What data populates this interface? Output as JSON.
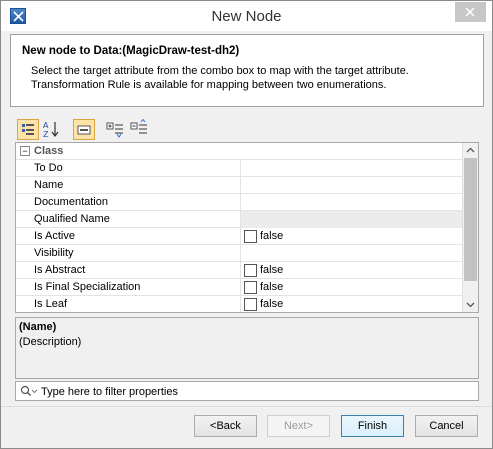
{
  "window": {
    "title": "New Node"
  },
  "header": {
    "title": "New node to Data:(MagicDraw-test-dh2)",
    "line1": "Select the target attribute from the combo box to map with the target attribute.",
    "line2": "Transformation Rule is available for mapping between two enumerations."
  },
  "toolbar": {
    "buttons": [
      "categorized-view",
      "alphabetic-sort",
      "show-descriptions",
      "expand-all",
      "collapse-all"
    ]
  },
  "grid": {
    "group": "Class",
    "rows": [
      {
        "name": "To Do",
        "value": ""
      },
      {
        "name": "Name",
        "value": ""
      },
      {
        "name": "Documentation",
        "value": ""
      },
      {
        "name": "Qualified Name",
        "value": ""
      },
      {
        "name": "Is Active",
        "value": "false"
      },
      {
        "name": "Visibility",
        "value": ""
      },
      {
        "name": "Is Abstract",
        "value": "false"
      },
      {
        "name": "Is Final Specialization",
        "value": "false"
      },
      {
        "name": "Is Leaf",
        "value": "false"
      }
    ]
  },
  "description": {
    "title": "(Name)",
    "text": "(Description)"
  },
  "filter": {
    "placeholder": "Type here to filter properties"
  },
  "footer": {
    "back": "<Back",
    "next": "Next>",
    "finish": "Finish",
    "cancel": "Cancel"
  }
}
